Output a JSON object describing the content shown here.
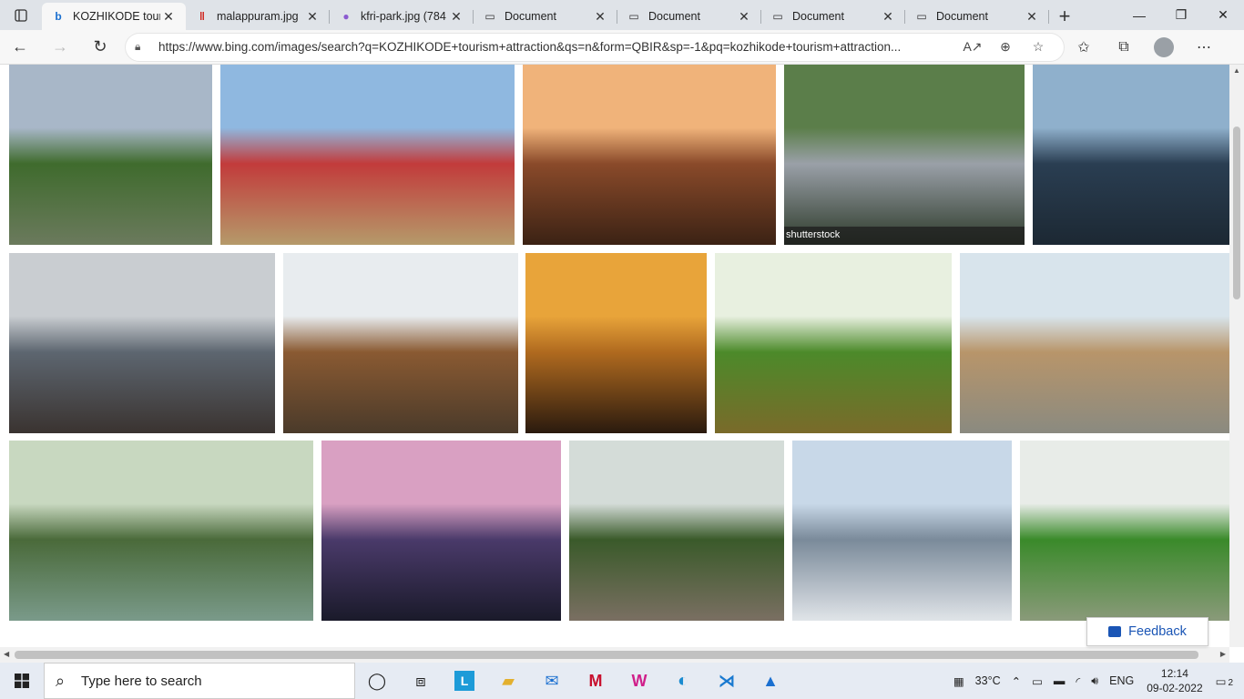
{
  "tabs": [
    {
      "title": "KOZHIKODE tour",
      "icon": "bing-icon",
      "active": true
    },
    {
      "title": "malappuram.jpg",
      "icon": "pdf-icon",
      "active": false
    },
    {
      "title": "kfri-park.jpg (784",
      "icon": "image-icon",
      "active": false
    },
    {
      "title": "Document",
      "icon": "document-icon",
      "active": false
    },
    {
      "title": "Document",
      "icon": "document-icon",
      "active": false
    },
    {
      "title": "Document",
      "icon": "document-icon",
      "active": false
    },
    {
      "title": "Document",
      "icon": "document-icon",
      "active": false
    }
  ],
  "address": {
    "url": "https://www.bing.com/images/search?q=KOZHIKODE+tourism+attraction&qs=n&form=QBIR&sp=-1&pq=kozhikode+tourism+attraction..."
  },
  "images": [
    {
      "name": "backwater-palms",
      "caption": "",
      "colors": [
        "#a8b7c8",
        "#3f6b2d",
        "#6b7a5d"
      ]
    },
    {
      "name": "lighthouse-beach",
      "caption": "",
      "colors": [
        "#8fb8e0",
        "#c23b3b",
        "#b59a6a"
      ]
    },
    {
      "name": "pier-sunset",
      "caption": "",
      "colors": [
        "#f0b37a",
        "#8a4a2a",
        "#3b2214"
      ]
    },
    {
      "name": "dam-shutterstock",
      "caption": "shutterstock",
      "colors": [
        "#5b7e4a",
        "#9aa0a8",
        "#2d3a2a"
      ]
    },
    {
      "name": "pier-silhouette",
      "caption": "",
      "colors": [
        "#8fb0cc",
        "#2a3e52",
        "#1c2833"
      ]
    },
    {
      "name": "pier-ruins-cloudy",
      "caption": "",
      "colors": [
        "#c9cdd1",
        "#5d6670",
        "#3a3330"
      ]
    },
    {
      "name": "wooden-ship",
      "caption": "",
      "colors": [
        "#e8ecef",
        "#8a5a32",
        "#4a3a2a"
      ]
    },
    {
      "name": "sea-sunset-rocks",
      "caption": "",
      "colors": [
        "#e8a43a",
        "#b06a1f",
        "#2a1a0e"
      ]
    },
    {
      "name": "palm-backwaters",
      "caption": "",
      "colors": [
        "#e8f0e0",
        "#4c8a2a",
        "#7a6a2a"
      ]
    },
    {
      "name": "fort-square",
      "caption": "",
      "colors": [
        "#d8e4ec",
        "#b8956a",
        "#8a8a80"
      ]
    },
    {
      "name": "lake-boathouse",
      "caption": "",
      "colors": [
        "#c8d8c0",
        "#4a6a3a",
        "#7a9a8a"
      ]
    },
    {
      "name": "dusk-promenade",
      "caption": "",
      "colors": [
        "#d9a0c2",
        "#4a3a6a",
        "#1a1a2a"
      ]
    },
    {
      "name": "waterfall-rocks",
      "caption": "",
      "colors": [
        "#d4dcd8",
        "#3a5a2a",
        "#7a6f62"
      ]
    },
    {
      "name": "city-beach",
      "caption": "",
      "colors": [
        "#c8d8e8",
        "#7a8a9a",
        "#e0e4e8"
      ]
    },
    {
      "name": "mangrove-island",
      "caption": "",
      "colors": [
        "#e8ece8",
        "#3a8a2a",
        "#8a9a7a"
      ]
    }
  ],
  "feedback": {
    "label": "Feedback"
  },
  "taskbar": {
    "search_placeholder": "Type here to search",
    "temperature": "33°C",
    "language": "ENG",
    "time": "12:14",
    "date": "09-02-2022",
    "notifications": "2"
  }
}
